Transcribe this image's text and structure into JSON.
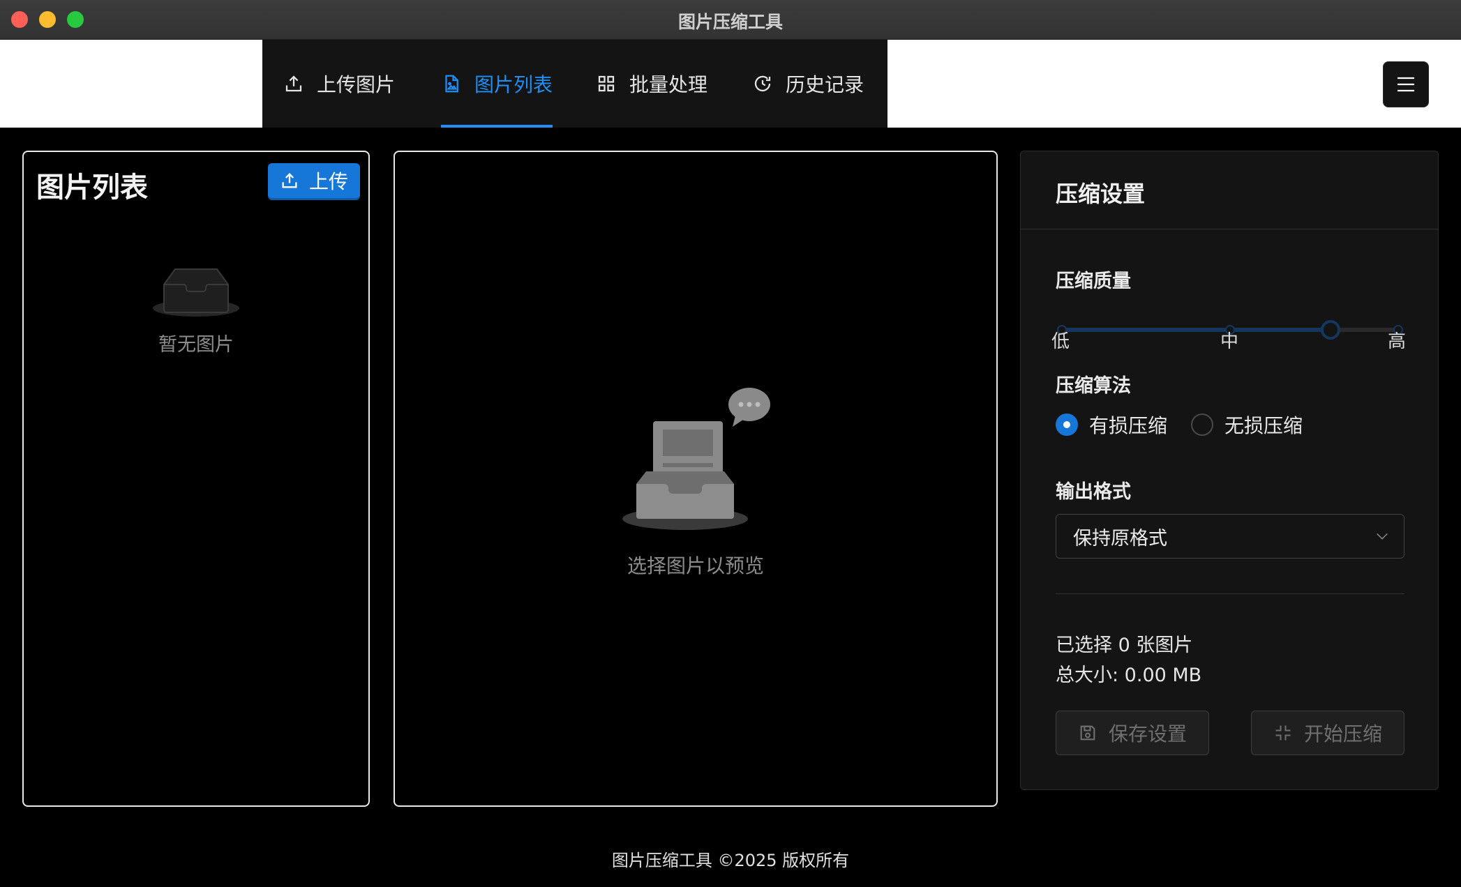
{
  "window": {
    "title": "图片压缩工具"
  },
  "menu": {
    "items": [
      {
        "label": "上传图片",
        "icon": "upload-icon"
      },
      {
        "label": "图片列表",
        "icon": "file-image-icon",
        "active": true
      },
      {
        "label": "批量处理",
        "icon": "grid-icon"
      },
      {
        "label": "历史记录",
        "icon": "history-icon"
      }
    ]
  },
  "image_list": {
    "title": "图片列表",
    "upload_button": "上传",
    "empty_text": "暂无图片"
  },
  "preview": {
    "empty_text": "选择图片以预览"
  },
  "settings": {
    "title": "压缩设置",
    "quality": {
      "label": "压缩质量",
      "marks": [
        "低",
        "中",
        "高"
      ],
      "value_fraction": 0.8
    },
    "algorithm": {
      "label": "压缩算法",
      "options": [
        "有损压缩",
        "无损压缩"
      ],
      "selected": "有损压缩"
    },
    "output_format": {
      "label": "输出格式",
      "value": "保持原格式"
    },
    "selected_info": "已选择 0 张图片",
    "total_size": "总大小: 0.00 MB",
    "save_button": "保存设置",
    "start_button": "开始压缩"
  },
  "footer": {
    "text": "图片压缩工具 ©2025 版权所有"
  },
  "colors": {
    "accent": "#1677d9",
    "active_tab": "#1f8ef5",
    "slider_track": "#15375d"
  }
}
